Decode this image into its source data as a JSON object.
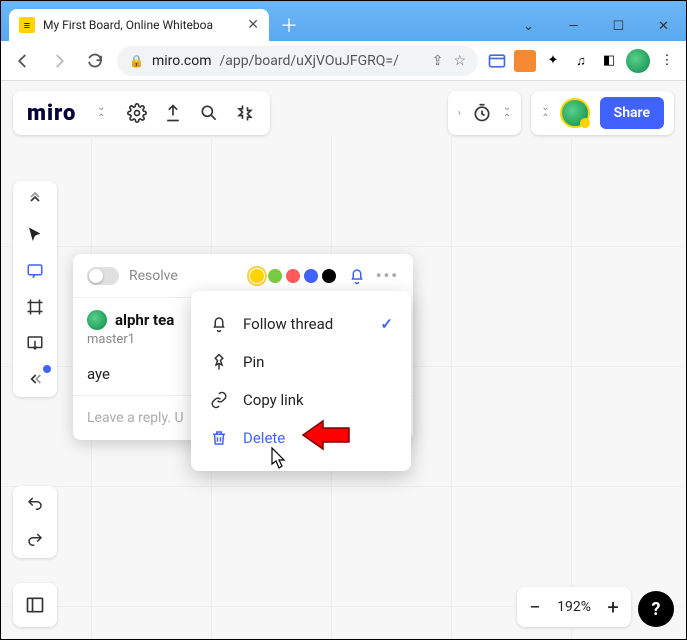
{
  "browser": {
    "tab_title": "My First Board, Online Whiteboa",
    "url_host": "miro.com",
    "url_path": "/app/board/uXjVOuJFGRQ=/"
  },
  "app": {
    "logo": "miro",
    "share_label": "Share"
  },
  "colors": [
    "#ffd400",
    "#7ac943",
    "#ff5c5c",
    "#4262ff",
    "#000000"
  ],
  "comment": {
    "resolve_label": "Resolve",
    "author": "alphr tea",
    "subline": "master1",
    "message": "aye",
    "reply_placeholder": "Leave a reply. U"
  },
  "menu": {
    "follow": "Follow thread",
    "pin": "Pin",
    "copy": "Copy link",
    "delete": "Delete"
  },
  "zoom": {
    "level": "192%"
  }
}
